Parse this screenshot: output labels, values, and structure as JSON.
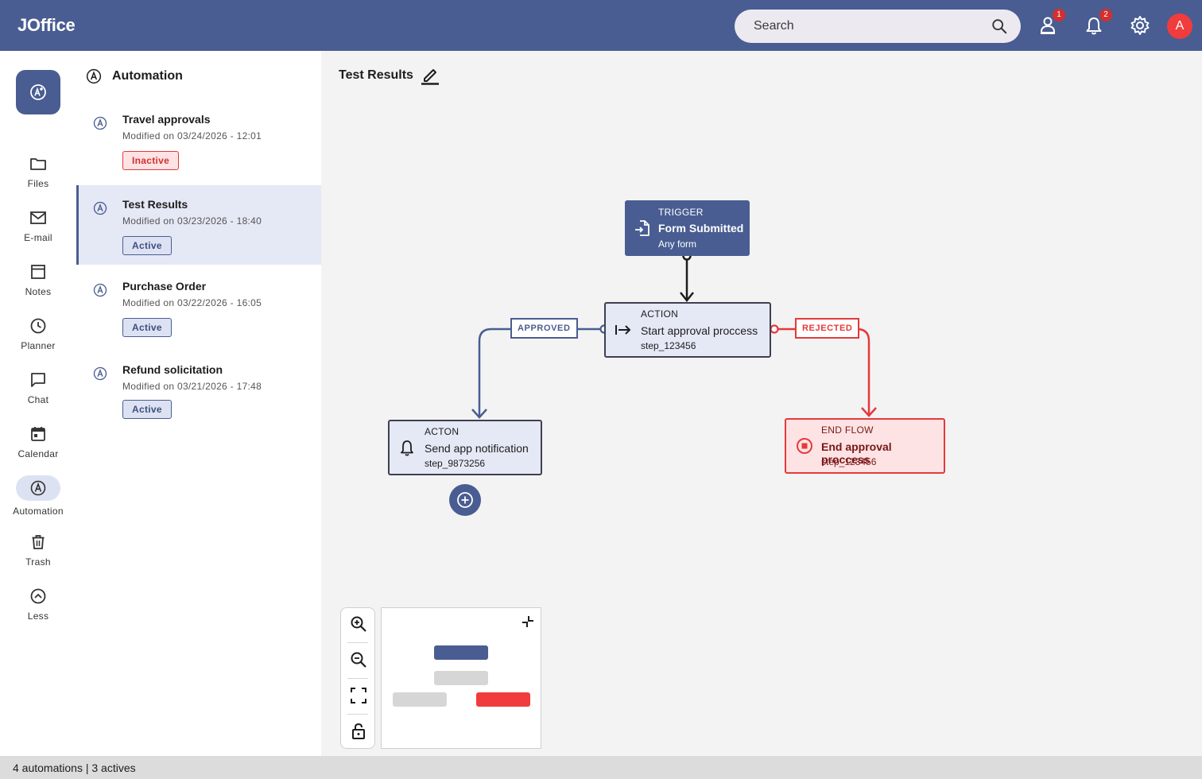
{
  "app": {
    "name": "JOffice"
  },
  "header": {
    "search_placeholder": "Search",
    "tasks_badge": "1",
    "notifications_badge": "2",
    "avatar_initial": "A"
  },
  "rail": {
    "items": [
      {
        "label": "Files",
        "icon": "folder-icon"
      },
      {
        "label": "E-mail",
        "icon": "mail-icon"
      },
      {
        "label": "Notes",
        "icon": "notes-icon"
      },
      {
        "label": "Planner",
        "icon": "clock-icon"
      },
      {
        "label": "Chat",
        "icon": "chat-icon"
      },
      {
        "label": "Calendar",
        "icon": "calendar-icon"
      },
      {
        "label": "Automation",
        "icon": "automation-icon",
        "active": true
      },
      {
        "label": "Trash",
        "icon": "trash-icon"
      },
      {
        "label": "Less",
        "icon": "chevron-up-icon"
      }
    ]
  },
  "list": {
    "title": "Automation",
    "items": [
      {
        "name": "Travel approvals",
        "modified": "Modified on 03/24/2026 - 12:01",
        "status": "Inactive"
      },
      {
        "name": "Test Results",
        "modified": "Modified on 03/23/2026 - 18:40",
        "status": "Active",
        "selected": true
      },
      {
        "name": "Purchase Order",
        "modified": "Modified on 03/22/2026 - 16:05",
        "status": "Active"
      },
      {
        "name": "Refund solicitation",
        "modified": "Modified on 03/21/2026 - 17:48",
        "status": "Active"
      }
    ]
  },
  "canvas": {
    "title": "Test Results",
    "nodes": {
      "trigger": {
        "kind": "TRIGGER",
        "title": "Form Submitted",
        "sub": "Any form"
      },
      "action": {
        "kind": "ACTION",
        "title": "Start approval proccess",
        "sub": "step_123456"
      },
      "notify": {
        "kind": "ACTON",
        "title": "Send app notification",
        "sub": "step_9873256"
      },
      "end": {
        "kind": "END FLOW",
        "title": "End approval proccess",
        "sub": "step_123456"
      }
    },
    "edges": {
      "approved": "APPROVED",
      "rejected": "REJECTED"
    }
  },
  "colors": {
    "primary": "#495d92",
    "danger": "#e5393b",
    "node_bg": "#e5e8f5",
    "end_bg": "#fde3e3"
  },
  "status_bar": "4 automations | 3 actives"
}
